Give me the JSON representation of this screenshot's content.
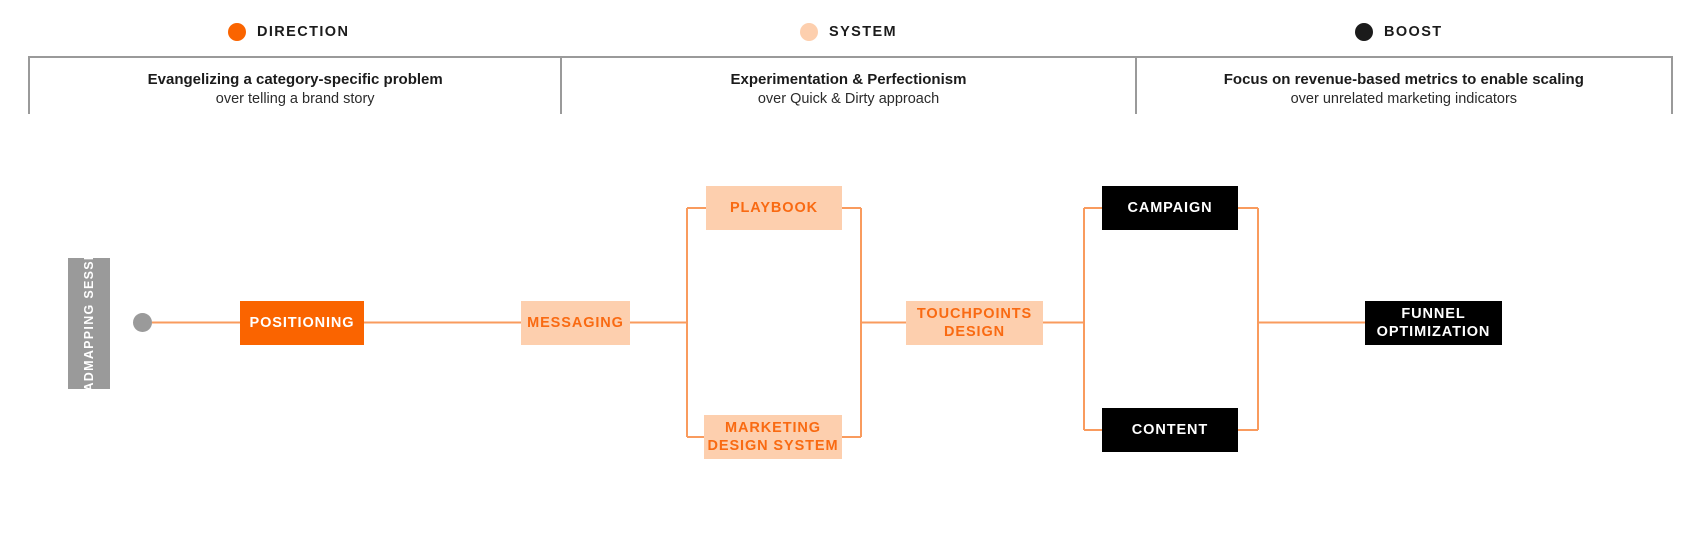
{
  "legend": {
    "items": [
      {
        "label": "DIRECTION",
        "dot_color": "#fa6400",
        "icon": "filled-circle-icon"
      },
      {
        "label": "SYSTEM",
        "dot_color": "#fdcfae",
        "icon": "filled-circle-icon"
      },
      {
        "label": "BOOST",
        "dot_color": "#1b1b1b",
        "icon": "filled-circle-icon"
      }
    ]
  },
  "phases": [
    {
      "title": "Evangelizing a category-specific problem",
      "subtitle": "over telling a brand story"
    },
    {
      "title": "Experimentation & Perfectionism",
      "subtitle": "over Quick & Dirty approach"
    },
    {
      "title": "Focus on revenue-based metrics to enable scaling",
      "subtitle": "over unrelated marketing indicators"
    }
  ],
  "flow": {
    "start_label": "ROADMAPPING SESSION",
    "nodes": {
      "positioning": "POSITIONING",
      "messaging": "MESSAGING",
      "playbook": "PLAYBOOK",
      "marketing_design_system": "MARKETING DESIGN SYSTEM",
      "touchpoints_design": "TOUCHPOINTS DESIGN",
      "campaign": "CAMPAIGN",
      "content": "CONTENT",
      "funnel_optimization": "FUNNEL OPTIMIZATION"
    }
  },
  "colors": {
    "accent_solid": "#fa6400",
    "accent_light": "#fdcfae",
    "connector": "#f99b5e",
    "neutral": "#9a9a9a",
    "black": "#000000",
    "text_dark": "#1b1b1b"
  }
}
